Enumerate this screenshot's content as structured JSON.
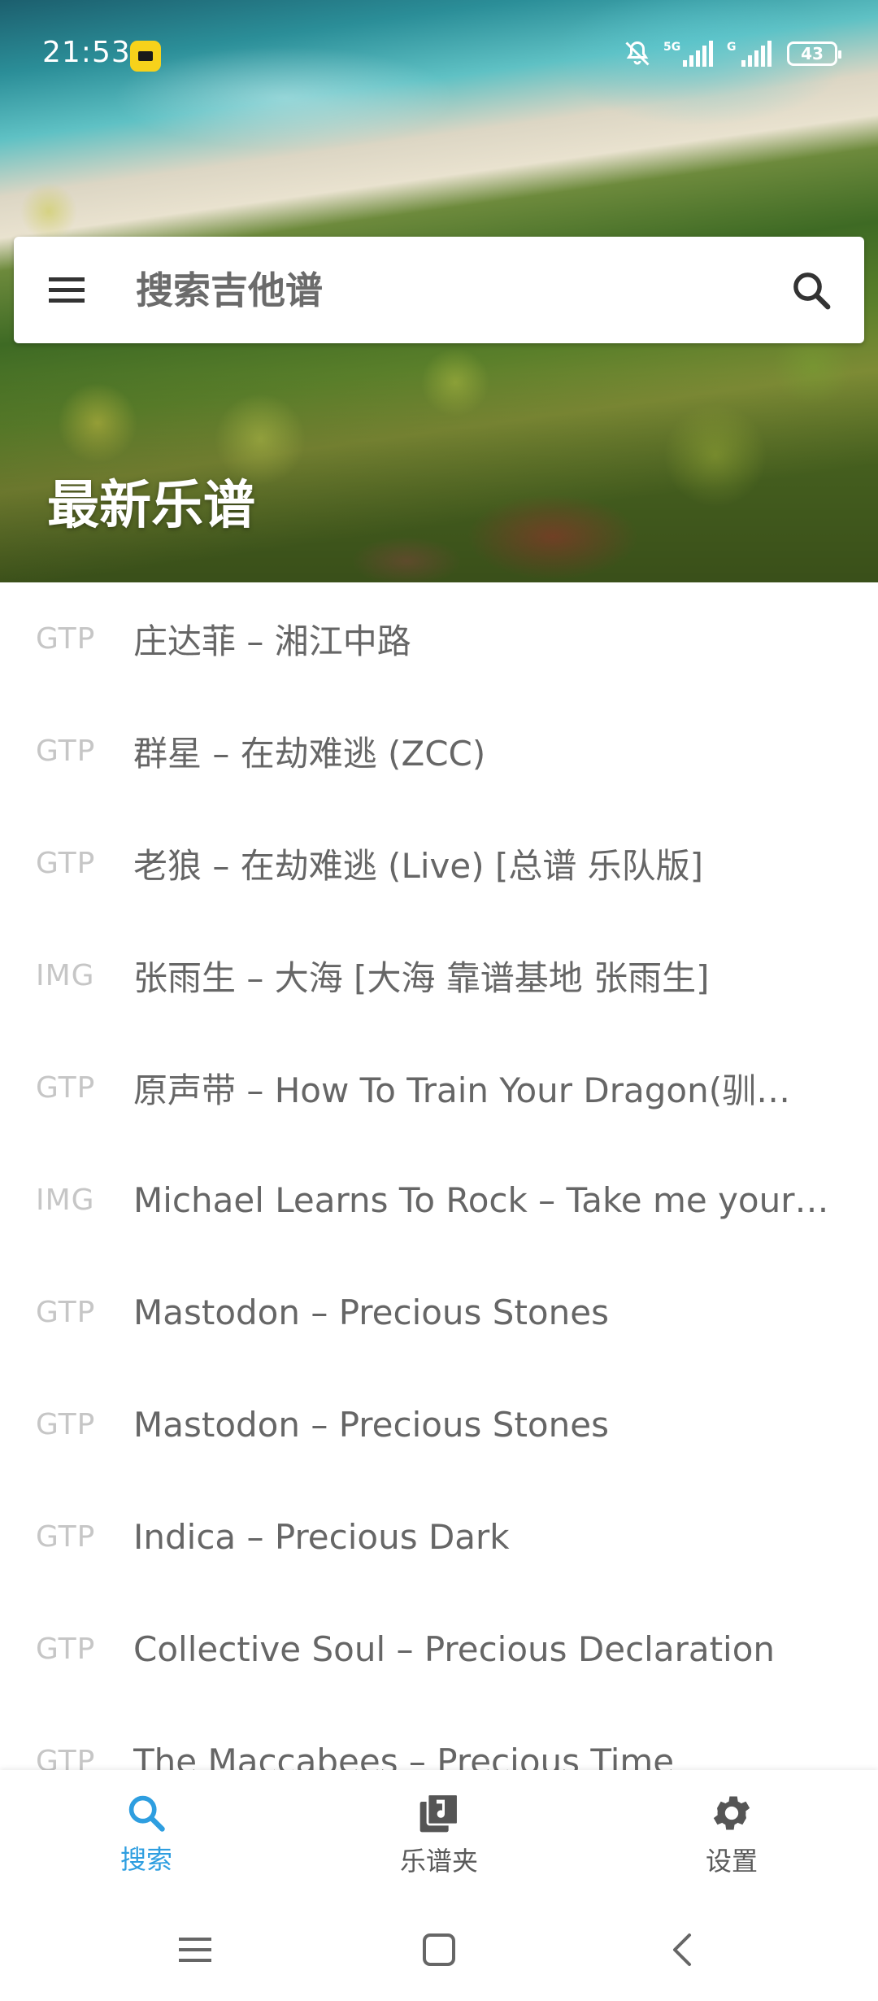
{
  "status_bar": {
    "time": "21:53",
    "battery": "43",
    "network": "5G"
  },
  "search": {
    "placeholder": "搜索吉他谱"
  },
  "hero": {
    "title": "最新乐谱"
  },
  "list": [
    {
      "type": "GTP",
      "title": "庄达菲 – 湘江中路"
    },
    {
      "type": "GTP",
      "title": "群星 – 在劫难逃 (ZCC)"
    },
    {
      "type": "GTP",
      "title": "老狼 – 在劫难逃 (Live) [总谱 乐队版]"
    },
    {
      "type": "IMG",
      "title": "张雨生 – 大海 [大海 靠谱基地 张雨生]"
    },
    {
      "type": "GTP",
      "title": "原声带 – How To Train Your Dragon(驯…"
    },
    {
      "type": "IMG",
      "title": "Michael Learns To Rock – Take me your…"
    },
    {
      "type": "GTP",
      "title": "Mastodon – Precious Stones"
    },
    {
      "type": "GTP",
      "title": "Mastodon – Precious Stones"
    },
    {
      "type": "GTP",
      "title": "Indica – Precious Dark"
    },
    {
      "type": "GTP",
      "title": "Collective Soul – Precious Declaration"
    },
    {
      "type": "GTP",
      "title": "The Maccabees – Precious Time"
    }
  ],
  "nav": {
    "tabs": [
      {
        "label": "搜索",
        "icon": "search-icon",
        "active": true
      },
      {
        "label": "乐谱夹",
        "icon": "music-library-icon",
        "active": false
      },
      {
        "label": "设置",
        "icon": "gear-icon",
        "active": false
      }
    ]
  },
  "colors": {
    "accent": "#2e9ee0",
    "list_text": "#666666",
    "type_text": "#c6c6c6"
  }
}
